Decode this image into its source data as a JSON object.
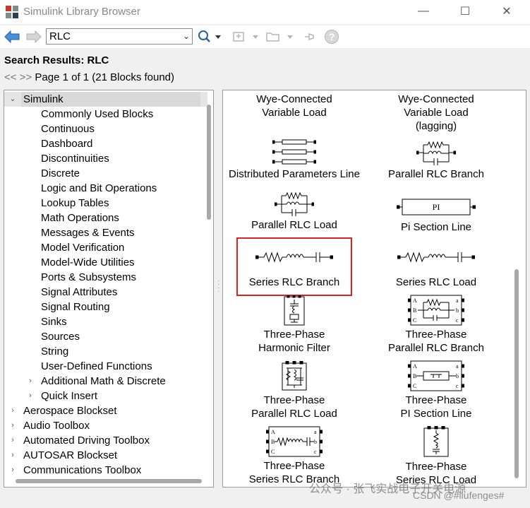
{
  "window": {
    "title": "Simulink Library Browser",
    "minimize_glyph": "—",
    "maximize_glyph": "☐",
    "close_glyph": "✕"
  },
  "toolbar": {
    "search_value": "RLC"
  },
  "results": {
    "title": "Search Results: RLC",
    "nav_glyphs": "<< >>",
    "page_text": "Page 1 of 1 (21 Blocks found)"
  },
  "tree": {
    "root": "Simulink",
    "children": [
      "Commonly Used Blocks",
      "Continuous",
      "Dashboard",
      "Discontinuities",
      "Discrete",
      "Logic and Bit Operations",
      "Lookup Tables",
      "Math Operations",
      "Messages & Events",
      "Model Verification",
      "Model-Wide Utilities",
      "Ports & Subsystems",
      "Signal Attributes",
      "Signal Routing",
      "Sinks",
      "Sources",
      "String",
      "User-Defined Functions",
      "Additional Math & Discrete",
      "Quick Insert"
    ],
    "top_level": [
      "Aerospace Blockset",
      "Audio Toolbox",
      "Automated Driving Toolbox",
      "AUTOSAR Blockset",
      "Communications Toolbox"
    ]
  },
  "blocks": [
    {
      "line1": "Wye-Connected",
      "line2": "Variable Load",
      "line3": ""
    },
    {
      "line1": "Wye-Connected",
      "line2": "Variable Load",
      "line3": "(lagging)"
    },
    {
      "line1": "Distributed Parameters Line",
      "line2": "",
      "line3": ""
    },
    {
      "line1": "Parallel RLC Branch",
      "line2": "",
      "line3": ""
    },
    {
      "line1": "Parallel RLC Load",
      "line2": "",
      "line3": ""
    },
    {
      "line1": "Pi Section Line",
      "line2": "",
      "line3": "",
      "icon_text": "PI"
    },
    {
      "line1": "Series RLC Branch",
      "line2": "",
      "line3": ""
    },
    {
      "line1": "Series RLC Load",
      "line2": "",
      "line3": ""
    },
    {
      "line1": "Three-Phase",
      "line2": "Harmonic Filter",
      "line3": ""
    },
    {
      "line1": "Three-Phase",
      "line2": "Parallel RLC Branch",
      "line3": "",
      "ports": [
        "A",
        "B",
        "C",
        "a",
        "b",
        "c"
      ]
    },
    {
      "line1": "Three-Phase",
      "line2": "Parallel RLC Load",
      "line3": ""
    },
    {
      "line1": "Three-Phase",
      "line2": "PI Section Line",
      "line3": "",
      "ports": [
        "A",
        "B",
        "C",
        "a",
        "b",
        "c"
      ]
    },
    {
      "line1": "Three-Phase",
      "line2": "Series RLC Branch",
      "line3": "",
      "ports": [
        "A",
        "B",
        "C",
        "a",
        "b",
        "c"
      ]
    },
    {
      "line1": "Three-Phase",
      "line2": "Series RLC Load",
      "line3": ""
    }
  ],
  "watermark": {
    "line1": "公众号 · 张飞实战电子开关电源",
    "line2": "CSDN @#liufenges#"
  },
  "colors": {
    "highlight": "#e02020",
    "selection": "#e5e5e5",
    "accent_blue": "#1a6fc9"
  }
}
